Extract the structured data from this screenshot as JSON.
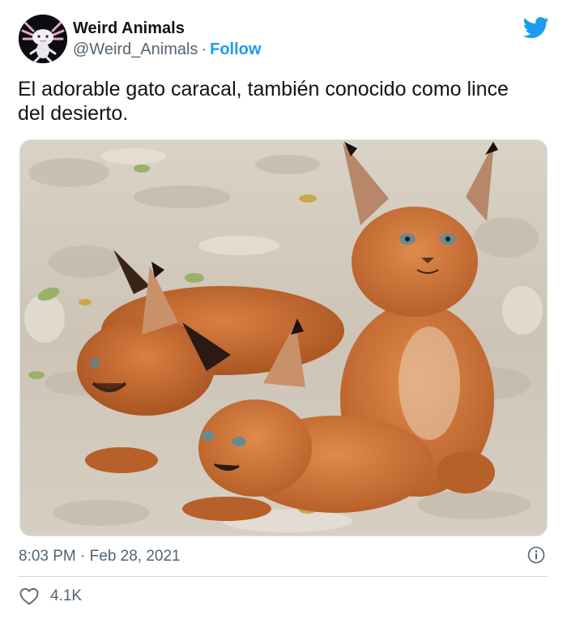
{
  "author": {
    "name": "Weird Animals",
    "handle": "@Weird_Animals",
    "separator": "·",
    "follow_label": "Follow",
    "avatar_icon": "axolotl-avatar",
    "verified_brand_icon": "twitter-bird-icon"
  },
  "tweet": {
    "text": "El adorable gato caracal, también conocido como lince del desierto.",
    "media": {
      "type": "photo",
      "subject": "caracal-kittens"
    },
    "timestamp": "8:03 PM · Feb 28, 2021",
    "likes": "4.1K"
  },
  "colors": {
    "accent": "#1d9bf0",
    "secondary_text": "#536471",
    "primary_text": "#0f1419",
    "divider": "#cfd9de"
  }
}
